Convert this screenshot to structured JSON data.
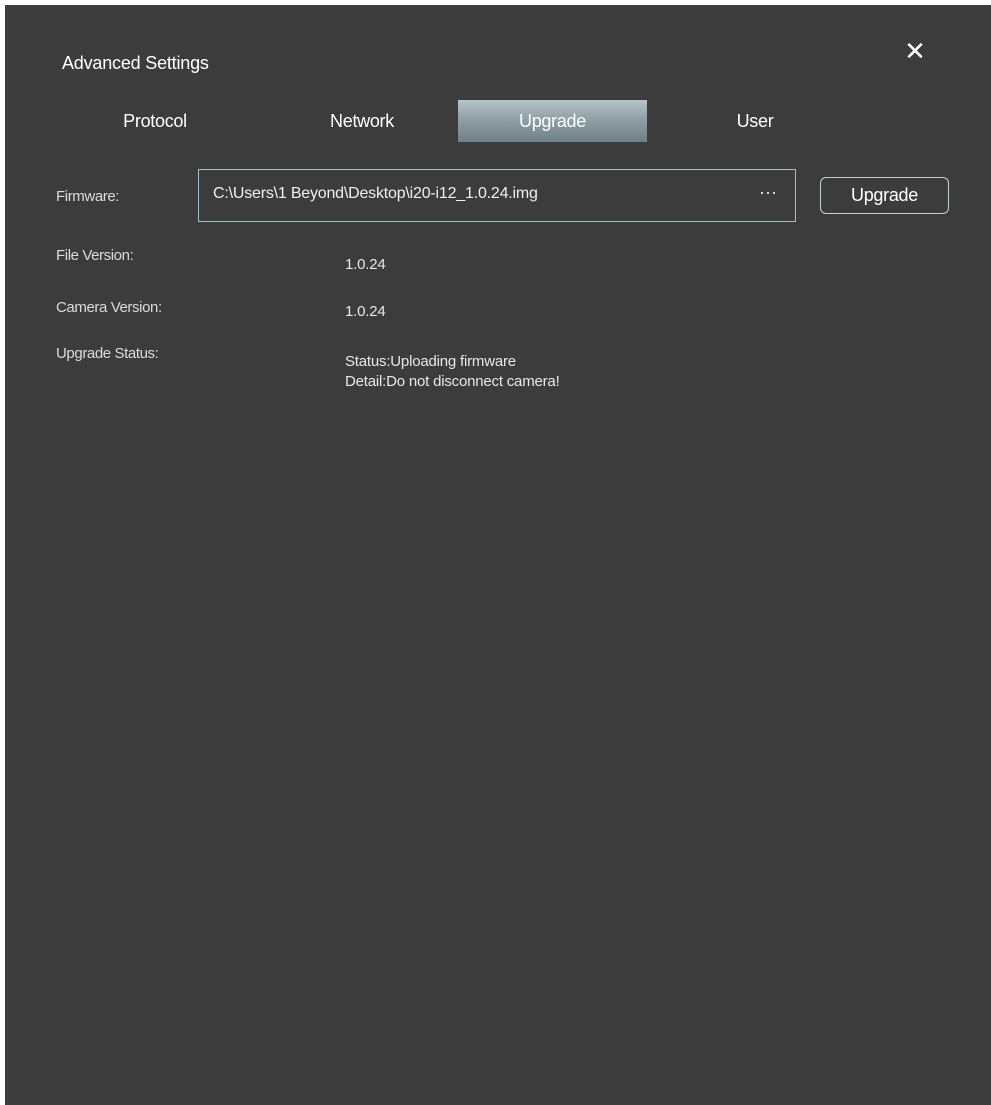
{
  "dialog": {
    "title": "Advanced Settings",
    "close_icon": "close-icon"
  },
  "tabs": [
    {
      "label": "Protocol",
      "active": false
    },
    {
      "label": "Network",
      "active": false
    },
    {
      "label": "Upgrade",
      "active": true
    },
    {
      "label": "User",
      "active": false
    }
  ],
  "firmware": {
    "label": "Firmware:",
    "path": "C:\\Users\\1 Beyond\\Desktop\\i20-i12_1.0.24.img",
    "browse_label": "···",
    "upgrade_button": "Upgrade"
  },
  "info": {
    "file_version_label": "File Version:",
    "file_version": "1.0.24",
    "camera_version_label": "Camera Version:",
    "camera_version": "1.0.24",
    "upgrade_status_label": "Upgrade Status:",
    "status_line": "Status:Uploading firmware",
    "detail_line": "Detail:Do not disconnect camera!"
  },
  "colors": {
    "background": "#3c3c3c",
    "active_tab": "#8fa0a6",
    "field_border": "#a9c0c2"
  }
}
